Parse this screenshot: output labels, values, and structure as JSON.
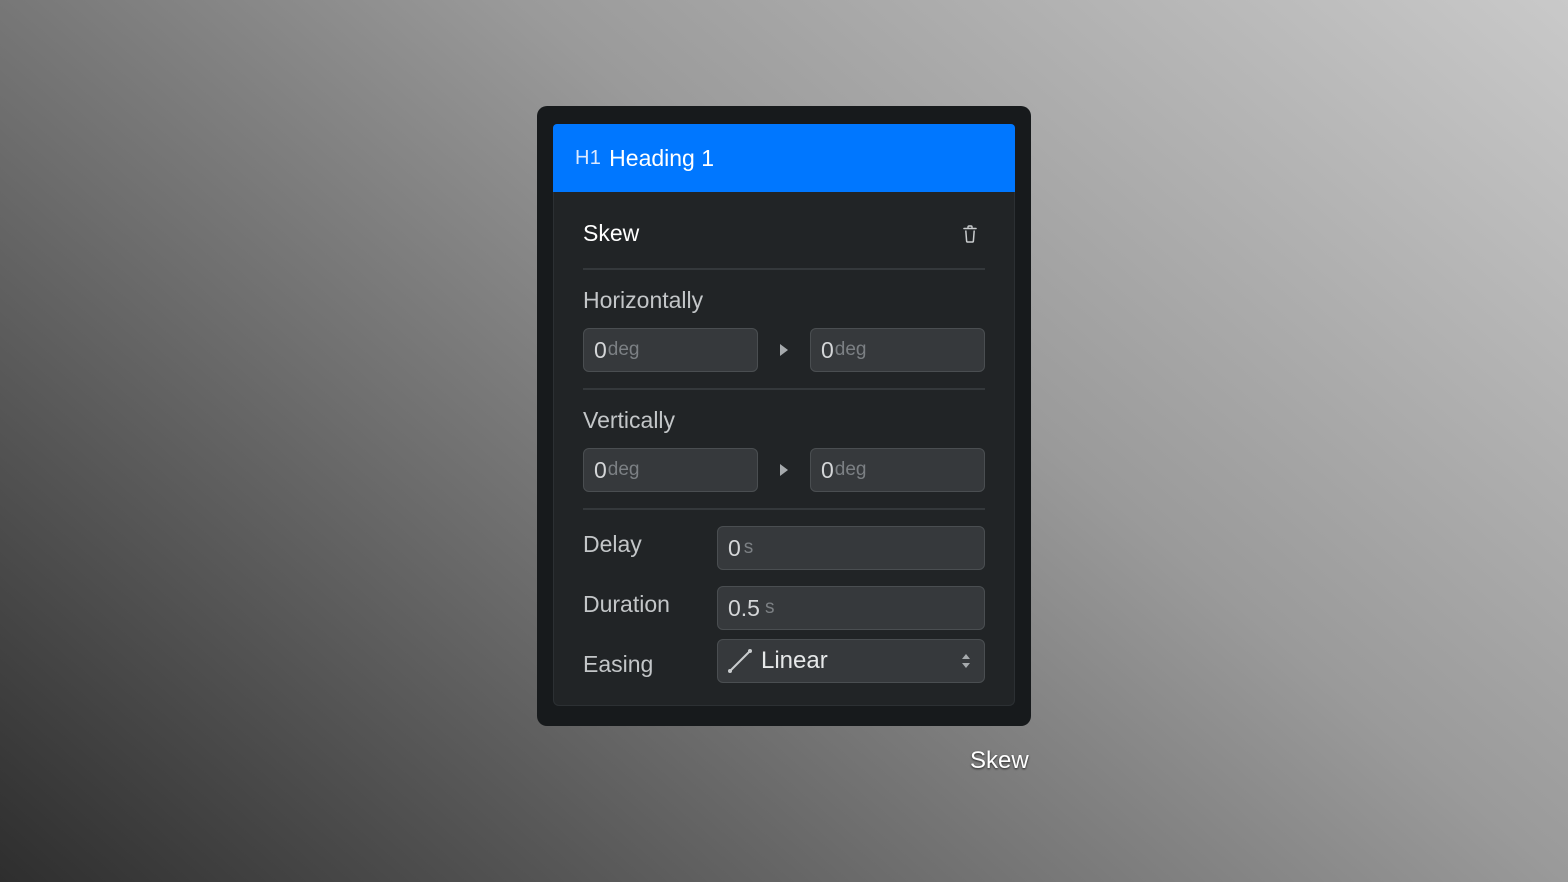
{
  "panel": {
    "header": {
      "tag": "H1",
      "title": "Heading 1",
      "color": "#0077ff"
    },
    "section": {
      "title": "Skew",
      "delete_icon": "trash-icon"
    },
    "horizontally": {
      "label": "Horizontally",
      "from": {
        "value": "0",
        "unit": "deg"
      },
      "to": {
        "value": "0",
        "unit": "deg"
      },
      "arrow_icon": "play-arrow-icon"
    },
    "vertically": {
      "label": "Vertically",
      "from": {
        "value": "0",
        "unit": "deg"
      },
      "to": {
        "value": "0",
        "unit": "deg"
      },
      "arrow_icon": "play-arrow-icon"
    },
    "delay": {
      "label": "Delay",
      "value": "0",
      "unit": "s"
    },
    "duration": {
      "label": "Duration",
      "value": "0.5",
      "unit": "s"
    },
    "easing": {
      "label": "Easing",
      "value": "Linear",
      "icon": "linear-curve-icon"
    }
  },
  "caption": "Skew"
}
